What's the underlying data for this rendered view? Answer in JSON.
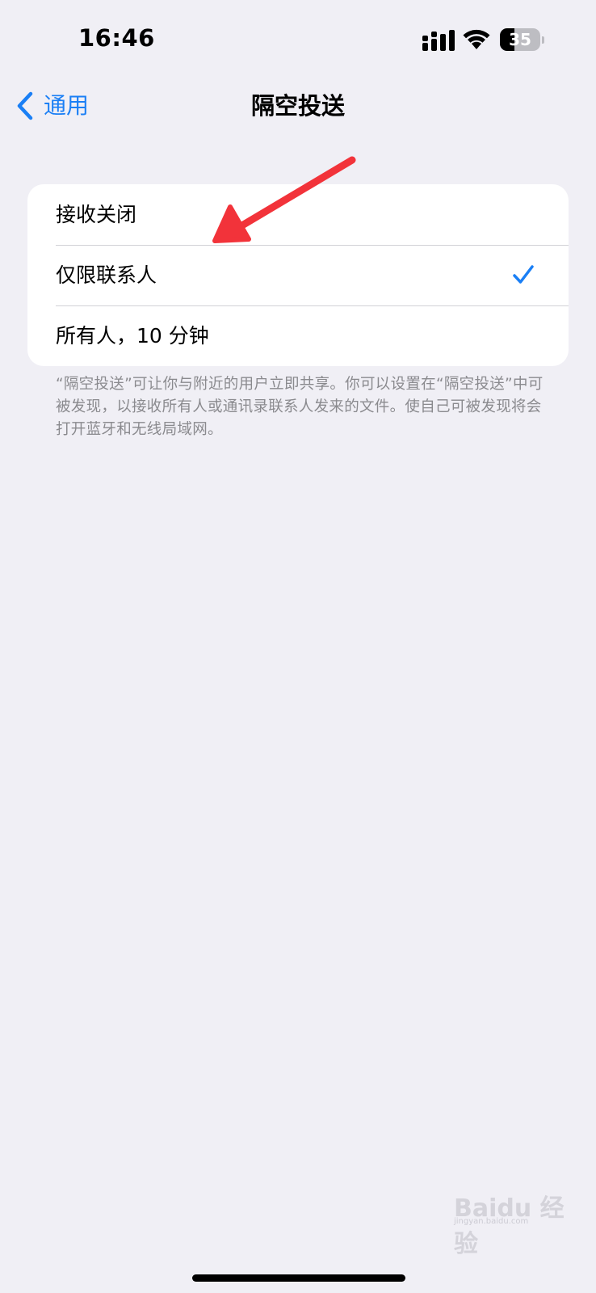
{
  "status_bar": {
    "time": "16:46",
    "battery_level": "35",
    "battery_fraction": 0.35,
    "icons": [
      "signal-icon",
      "wifi-icon",
      "battery-icon"
    ]
  },
  "nav": {
    "back_label": "通用",
    "title": "隔空投送"
  },
  "options": [
    {
      "label": "接收关闭",
      "selected": false
    },
    {
      "label": "仅限联系人",
      "selected": true
    },
    {
      "label": "所有人，10 分钟",
      "selected": false
    }
  ],
  "footer_note": "“隔空投送”可让你与附近的用户立即共享。你可以设置在“隔空投送”中可被发现，以接收所有人或通讯录联系人发来的文件。使自己可被发现将会打开蓝牙和无线局域网。",
  "colors": {
    "accent": "#1a7ff5",
    "annotation": "#f2333a",
    "background": "#f0eff5"
  },
  "watermark": {
    "logo": "Baidu 经验",
    "sub": "jingyan.baidu.com"
  }
}
